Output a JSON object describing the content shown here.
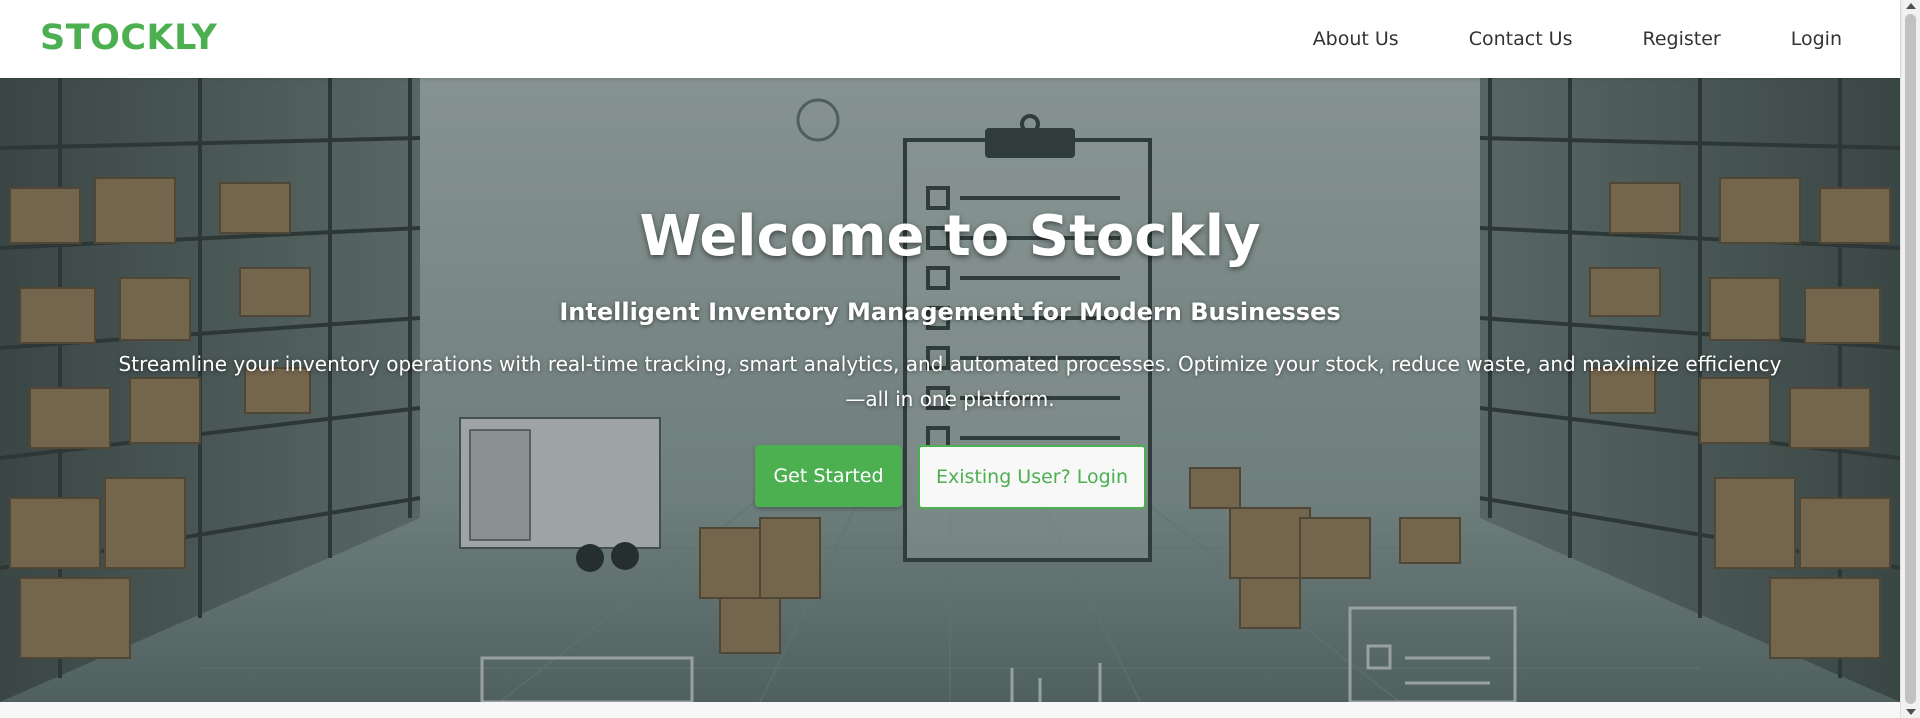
{
  "brand": {
    "name": "STOCKLY",
    "color": "#4caf50"
  },
  "nav": {
    "items": [
      {
        "label": "About Us"
      },
      {
        "label": "Contact Us"
      },
      {
        "label": "Register"
      },
      {
        "label": "Login"
      }
    ]
  },
  "hero": {
    "title": "Welcome to Stockly",
    "subtitle": "Intelligent Inventory Management for Modern Businesses",
    "description": "Streamline your inventory operations with real-time tracking, smart analytics, and automated processes. Optimize your stock, reduce waste, and maximize efficiency—all in one platform.",
    "background_image": "warehouse-illustration",
    "primary_button": "Get Started",
    "secondary_button": "Existing User? Login"
  },
  "colors": {
    "accent": "#4caf50",
    "nav_text": "#333333",
    "hero_text": "#ffffff"
  }
}
